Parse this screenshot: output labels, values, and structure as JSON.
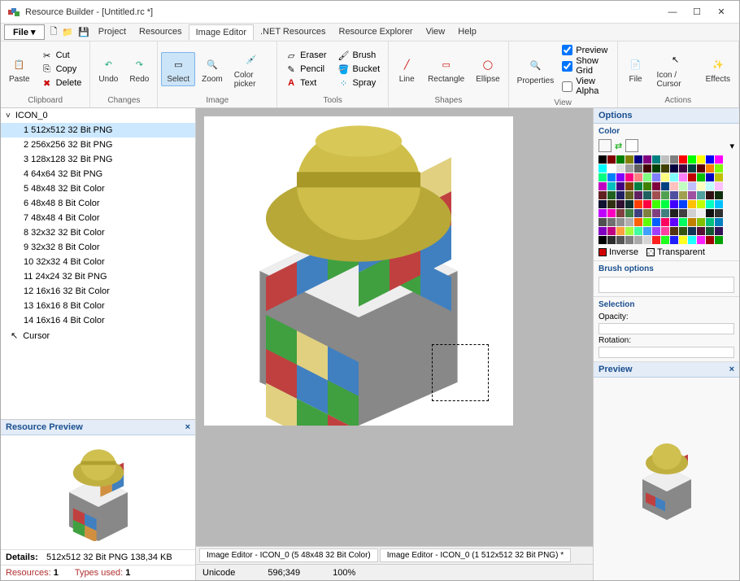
{
  "titlebar": {
    "title": "Resource Builder - [Untitled.rc *]"
  },
  "window_controls": {
    "minimize": "—",
    "maximize": "☐",
    "close": "✕"
  },
  "menubar": {
    "file": "File ▾",
    "tabs": [
      "Project",
      "Resources",
      "Image Editor",
      ".NET Resources",
      "Resource Explorer",
      "View",
      "Help"
    ],
    "active_tab": 2
  },
  "ribbon": {
    "clipboard": {
      "label": "Clipboard",
      "paste": "Paste",
      "cut": "Cut",
      "copy": "Copy",
      "delete": "Delete"
    },
    "changes": {
      "label": "Changes",
      "undo": "Undo",
      "redo": "Redo"
    },
    "image": {
      "label": "Image",
      "select": "Select",
      "zoom": "Zoom",
      "color_picker": "Color picker"
    },
    "tools": {
      "label": "Tools",
      "eraser": "Eraser",
      "brush": "Brush",
      "pencil": "Pencil",
      "bucket": "Bucket",
      "text": "Text",
      "spray": "Spray"
    },
    "shapes": {
      "label": "Shapes",
      "line": "Line",
      "rectangle": "Rectangle",
      "ellipse": "Ellipse"
    },
    "view": {
      "label": "View",
      "properties": "Properties",
      "preview": "Preview",
      "show_grid": "Show Grid",
      "view_alpha": "View Alpha",
      "preview_checked": true,
      "show_grid_checked": true,
      "view_alpha_checked": false
    },
    "actions": {
      "label": "Actions",
      "file": "File",
      "icon_cursor": "Icon / Cursor",
      "effects": "Effects"
    }
  },
  "tree": {
    "root": "ICON_0",
    "items": [
      "1 512x512 32 Bit PNG",
      "2 256x256 32 Bit PNG",
      "3 128x128 32 Bit PNG",
      "4 64x64 32 Bit PNG",
      "5 48x48 32 Bit Color",
      "6 48x48 8 Bit Color",
      "7 48x48 4 Bit Color",
      "8 32x32 32 Bit Color",
      "9 32x32 8 Bit Color",
      "10 32x32 4 Bit Color",
      "11 24x24 32 Bit PNG",
      "12 16x16 32 Bit Color",
      "13 16x16 8 Bit Color",
      "14 16x16 4 Bit Color"
    ],
    "selected_index": 0,
    "cursor": "Cursor"
  },
  "preview_panel": {
    "title": "Resource Preview",
    "details_label": "Details:",
    "details_value": "512x512 32 Bit PNG 138,34 KB",
    "resources_label": "Resources:",
    "resources_value": "1",
    "types_label": "Types used:",
    "types_value": "1"
  },
  "editor_tabs": [
    "Image Editor - ICON_0 (5 48x48 32 Bit Color)",
    "Image Editor - ICON_0 (1 512x512 32 Bit PNG) *"
  ],
  "statusbar": {
    "mode": "Unicode",
    "coords": "596;349",
    "zoom": "100%"
  },
  "options": {
    "header": "Options",
    "color_title": "Color",
    "fg_color": "#d00000",
    "bg_color": "#ffffff",
    "inverse": "Inverse",
    "transparent": "Transparent",
    "brush_title": "Brush options",
    "selection_title": "Selection",
    "opacity_label": "Opacity:",
    "rotation_label": "Rotation:",
    "preview_title": "Preview",
    "palette": [
      "#000000",
      "#800000",
      "#008000",
      "#808000",
      "#000080",
      "#800080",
      "#008080",
      "#c0c0c0",
      "#808080",
      "#ff0000",
      "#00ff00",
      "#ffff00",
      "#0000ff",
      "#ff00ff",
      "#00ffff",
      "#ffffff",
      "#e0e0e0",
      "#a0a0a0",
      "#606060",
      "#400000",
      "#004000",
      "#404000",
      "#000040",
      "#400040",
      "#004040",
      "#600000",
      "#ff8000",
      "#80ff00",
      "#00ff80",
      "#0080ff",
      "#8000ff",
      "#ff0080",
      "#ff8080",
      "#80ff80",
      "#8080ff",
      "#ffff80",
      "#80ffff",
      "#ff80ff",
      "#c00000",
      "#00c000",
      "#0000c0",
      "#c0c000",
      "#c000c0",
      "#00c0c0",
      "#400080",
      "#804000",
      "#008040",
      "#408000",
      "#800040",
      "#004080",
      "#ffc0c0",
      "#c0ffc0",
      "#c0c0ff",
      "#ffffc0",
      "#c0ffff",
      "#ffc0ff",
      "#602020",
      "#206020",
      "#202060",
      "#606020",
      "#602060",
      "#206060",
      "#a05050",
      "#50a050",
      "#5050a0",
      "#a0a050",
      "#a050a0",
      "#50a0a0",
      "#301010",
      "#103010",
      "#101030",
      "#303010",
      "#301030",
      "#103030",
      "#ff4000",
      "#ff0040",
      "#40ff00",
      "#00ff40",
      "#4000ff",
      "#0040ff",
      "#ffc000",
      "#c0ff00",
      "#00ffc0",
      "#00c0ff",
      "#c000ff",
      "#ff00c0",
      "#804040",
      "#408040",
      "#404080",
      "#808040",
      "#804080",
      "#408080",
      "#202020",
      "#404040",
      "#d0d0d0",
      "#f0f0f0",
      "#101010",
      "#303030",
      "#505050",
      "#707070",
      "#909090",
      "#b0b0b0",
      "#ff6000",
      "#60ff00",
      "#0060ff",
      "#ff0060",
      "#6000ff",
      "#00ff60",
      "#c08000",
      "#80c000",
      "#00c080",
      "#0080c0",
      "#8000c0",
      "#c00080",
      "#ffa040",
      "#a0ff40",
      "#40ffa0",
      "#40a0ff",
      "#a040ff",
      "#ff40a0",
      "#553311",
      "#335511",
      "#113355",
      "#551133",
      "#115533",
      "#331155",
      "#000000",
      "#2b2b2b",
      "#555555",
      "#808080",
      "#aaaaaa",
      "#d5d5d5",
      "#ff2020",
      "#20ff20",
      "#2020ff",
      "#ffff20",
      "#20ffff",
      "#ff20ff",
      "#a00000",
      "#00a000"
    ]
  }
}
